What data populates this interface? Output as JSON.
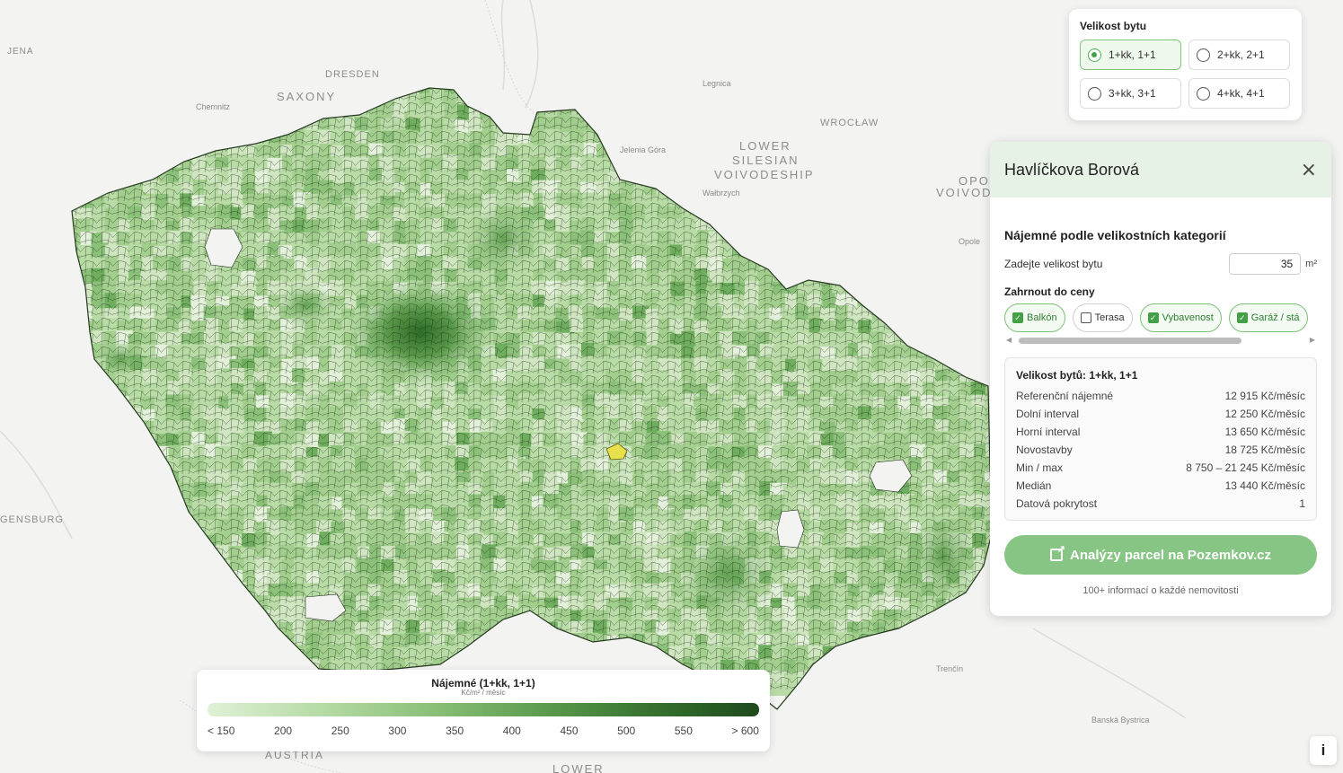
{
  "map": {
    "labels": [
      {
        "text": "JENA"
      },
      {
        "text": "DRESDEN"
      },
      {
        "text": "SAXONY"
      },
      {
        "text": "Chemnitz"
      },
      {
        "text": "Legnica"
      },
      {
        "text": "WROCŁAW"
      },
      {
        "text": "LOWER"
      },
      {
        "text": "SILESIAN"
      },
      {
        "text": "VOIVODESHIP"
      },
      {
        "text": "Jelenia Góra"
      },
      {
        "text": "Wałbrzych"
      },
      {
        "text": "OPOL"
      },
      {
        "text": "VOIVODE"
      },
      {
        "text": "Opole"
      },
      {
        "text": "GENSBURG"
      },
      {
        "text": "AUSTRIA"
      },
      {
        "text": "Trenčín"
      },
      {
        "text": "Banská Bystrica"
      },
      {
        "text": "LOWER"
      }
    ],
    "fill_colors": [
      "#e3f1da",
      "#cfe6c1",
      "#b9dca6",
      "#a2cf8d",
      "#8cc17a",
      "#6fae5e",
      "#559b48",
      "#3d8334",
      "#2b6a26"
    ],
    "selected_fill": "#e8e04a"
  },
  "size_selector": {
    "title": "Velikost bytu",
    "options": [
      {
        "label": "1+kk, 1+1",
        "selected": true
      },
      {
        "label": "2+kk, 2+1",
        "selected": false
      },
      {
        "label": "3+kk, 3+1",
        "selected": false
      },
      {
        "label": "4+kk, 4+1",
        "selected": false
      }
    ]
  },
  "panel": {
    "name": "Havlíčkova Borová",
    "close_icon": "×",
    "section_title": "Nájemné podle velikostních kategorií",
    "area_label": "Zadejte velikost bytu",
    "area_value": "35",
    "area_unit": "m²",
    "include_title": "Zahrnout do ceny",
    "chips": [
      {
        "label": "Balkón",
        "checked": true
      },
      {
        "label": "Terasa",
        "checked": false
      },
      {
        "label": "Vybavenost",
        "checked": true
      },
      {
        "label": "Garáž / stá",
        "checked": true
      }
    ],
    "stats_title": "Velikost bytů: 1+kk, 1+1",
    "stats": [
      {
        "label": "Referenční nájemné",
        "value": "12 915 Kč/měsíc"
      },
      {
        "label": "Dolní interval",
        "value": "12 250 Kč/měsíc"
      },
      {
        "label": "Horní interval",
        "value": "13 650 Kč/měsíc"
      },
      {
        "label": "Novostavby",
        "value": "18 725 Kč/měsíc"
      },
      {
        "label": "Min / max",
        "value": "8 750 – 21 245 Kč/měsíc"
      },
      {
        "label": "Medián",
        "value": "13 440 Kč/měsíc"
      },
      {
        "label": "Datová pokrytost",
        "value": "1"
      }
    ],
    "cta_label": "Analýzy parcel na Pozemkov.cz",
    "cta_sub": "100+ informací o každé nemovitosti"
  },
  "legend": {
    "title": "Nájemné (1+kk, 1+1)",
    "unit": "Kč/m² / měsíc",
    "ticks": [
      "< 150",
      "200",
      "250",
      "300",
      "350",
      "400",
      "450",
      "500",
      "550",
      "> 600"
    ]
  },
  "info_button": "i"
}
